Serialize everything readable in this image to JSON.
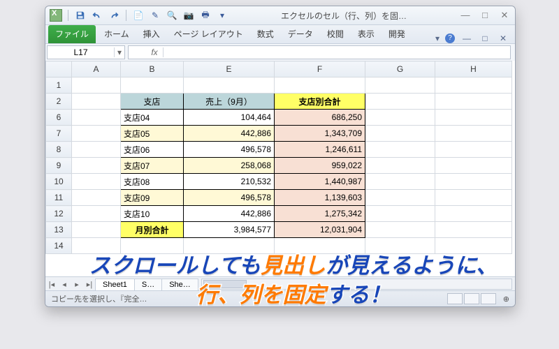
{
  "window": {
    "title": "エクセルのセル（行、列）を固…",
    "min": "—",
    "max": "□",
    "close": "✕"
  },
  "ribbon": {
    "file": "ファイル",
    "tabs": [
      "ホーム",
      "挿入",
      "ページ レイアウト",
      "数式",
      "データ",
      "校閲",
      "表示",
      "開発"
    ],
    "caret": "▾"
  },
  "fbar": {
    "cellref": "L17",
    "drop": "▾",
    "fx": "fx"
  },
  "cols": [
    "A",
    "B",
    "E",
    "F",
    "G",
    "H"
  ],
  "rows": [
    "1",
    "2",
    "6",
    "7",
    "8",
    "9",
    "10",
    "11",
    "12",
    "13",
    "14"
  ],
  "header": {
    "b": "支店",
    "e": "売上（9月）",
    "f": "支店別合計"
  },
  "data": [
    {
      "b": "支店04",
      "e": "104,464",
      "f": "686,250"
    },
    {
      "b": "支店05",
      "e": "442,886",
      "f": "1,343,709"
    },
    {
      "b": "支店06",
      "e": "496,578",
      "f": "1,246,611"
    },
    {
      "b": "支店07",
      "e": "258,068",
      "f": "959,022"
    },
    {
      "b": "支店08",
      "e": "210,532",
      "f": "1,440,987"
    },
    {
      "b": "支店09",
      "e": "496,578",
      "f": "1,139,603"
    },
    {
      "b": "支店10",
      "e": "442,886",
      "f": "1,275,342"
    }
  ],
  "totals": {
    "b": "月別合計",
    "e": "3,984,577",
    "f": "12,031,904"
  },
  "sheets": {
    "nav": [
      "|◂",
      "◂",
      "▸",
      "▸|"
    ],
    "tabs": [
      "Sheet1",
      "S…",
      "She…"
    ]
  },
  "status": {
    "text": "コピー先を選択し、『完全…",
    "plus": "⊕"
  },
  "caption": {
    "l1a": "スクロールしても",
    "l1b": "見出し",
    "l1c": "が見えるように、",
    "l2a": "行、列を固定",
    "l2b": "する！"
  }
}
